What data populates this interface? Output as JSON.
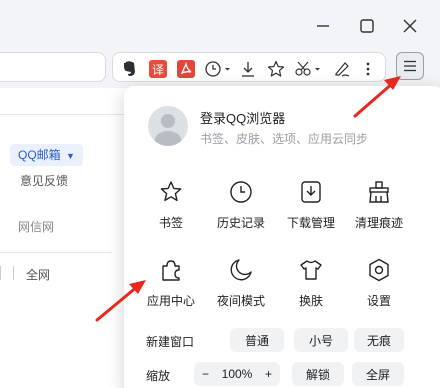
{
  "browser": {
    "window_controls": [
      "minimize-icon",
      "maximize-icon",
      "close-icon"
    ],
    "toolbar_icons": [
      "evernote-icon",
      "translate-icon",
      "pdf-icon",
      "history-icon",
      "download-icon",
      "favorite-star-icon",
      "screenshot-scissors-icon",
      "sign-pen-icon",
      "more-dots-icon"
    ],
    "translate_glyph": "译",
    "menu_icon": "hamburger-menu-icon"
  },
  "background_page": {
    "qqmail_label": "QQ邮箱",
    "feedback_label": "意见反馈",
    "wangxin_label": "网信网",
    "whole_net_label": "全网"
  },
  "menu": {
    "login_title": "登录QQ浏览器",
    "login_subtitle": "书签、皮肤、选项、应用云同步",
    "items": [
      {
        "label": "书签",
        "icon": "star-icon"
      },
      {
        "label": "历史记录",
        "icon": "clock-icon"
      },
      {
        "label": "下载管理",
        "icon": "download-icon"
      },
      {
        "label": "清理痕迹",
        "icon": "broom-icon"
      },
      {
        "label": "应用中心",
        "icon": "puzzle-icon"
      },
      {
        "label": "夜间模式",
        "icon": "moon-icon"
      },
      {
        "label": "换肤",
        "icon": "shirt-icon"
      },
      {
        "label": "设置",
        "icon": "settings-hexagon-icon"
      }
    ],
    "new_window_label": "新建窗口",
    "new_window_options": [
      "普通",
      "小号",
      "无痕"
    ],
    "zoom_label": "缩放",
    "zoom_minus": "−",
    "zoom_value": "100%",
    "zoom_plus": "+",
    "unlock_label": "解锁",
    "fullscreen_label": "全屏"
  },
  "annotation_color": "#e8281e"
}
